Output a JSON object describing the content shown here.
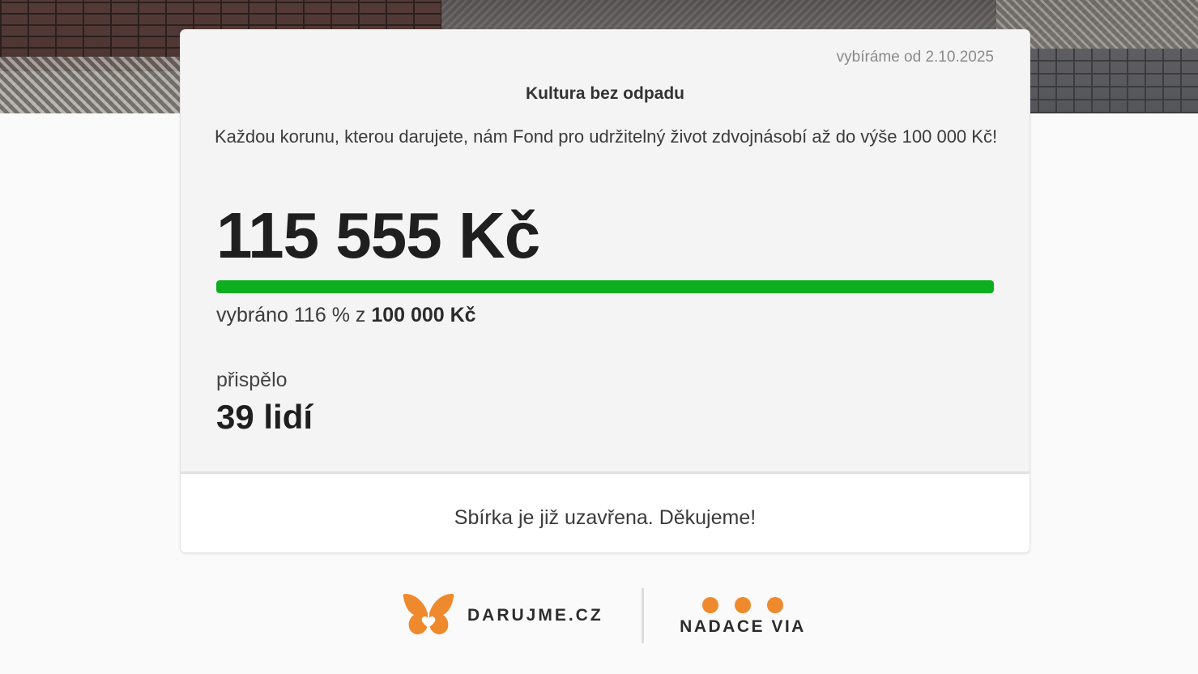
{
  "campaign": {
    "start_date": "vybíráme od 2.10.2025",
    "title": "Kultura bez odpadu",
    "description": "Každou korunu, kterou darujete, nám Fond pro udržitelný život zdvojnásobí až do výše 100 000 Kč!",
    "raised_amount": "115 555 Kč",
    "progress": {
      "percent_value": 116,
      "text_prefix": "vybráno 116 % z ",
      "goal": "100 000 Kč"
    },
    "donors": {
      "label": "přispělo",
      "count": "39 lidí"
    },
    "closed_message": "Sbírka je již uzavřena. Děkujeme!"
  },
  "footer": {
    "darujme_label": "DARUJME.CZ",
    "nadace_label": "NADACE VIA"
  },
  "colors": {
    "progress": "#0dae1f",
    "brand_orange": "#ee8a2d",
    "text_dark": "#1f1f1f"
  },
  "icons": {
    "darujme_logo": "butterfly-heart-icon",
    "nadace_logo": "three-dots-icon"
  }
}
